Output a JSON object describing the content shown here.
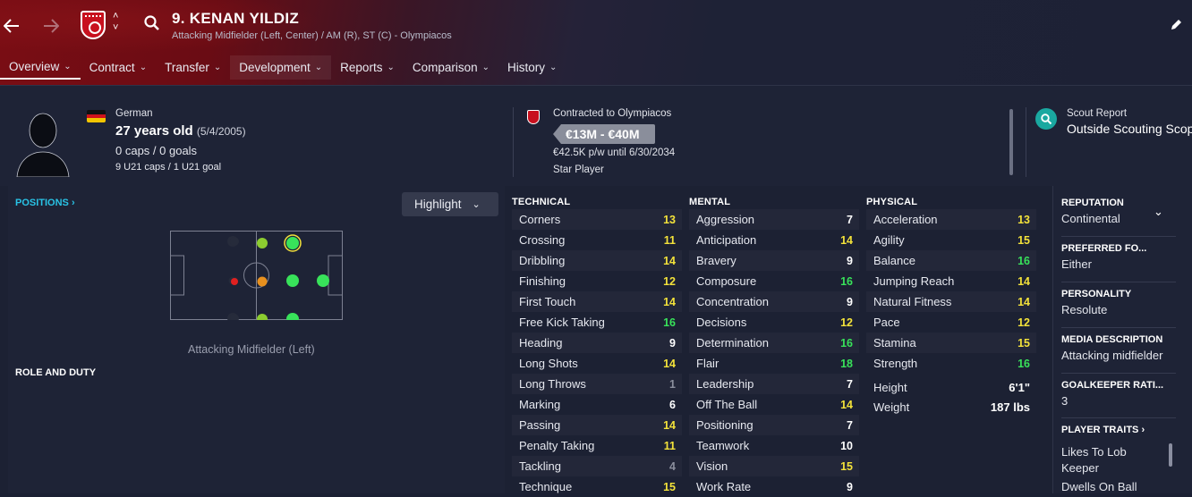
{
  "header": {
    "title": "9. KENAN YILDIZ",
    "subtitle": "Attacking Midfielder (Left, Center) / AM (R), ST (C) - Olympiacos",
    "back_icon": "arrow-left-icon",
    "forward_icon": "arrow-right-icon",
    "updown": [
      "˄",
      "˅"
    ]
  },
  "tabs": [
    {
      "label": "Overview"
    },
    {
      "label": "Contract"
    },
    {
      "label": "Transfer"
    },
    {
      "label": "Development"
    },
    {
      "label": "Reports"
    },
    {
      "label": "Comparison"
    },
    {
      "label": "History"
    }
  ],
  "player": {
    "nationality": "German",
    "age": "27 years old",
    "dob": "(5/4/2005)",
    "caps": "0 caps / 0 goals",
    "u21": "9 U21 caps / 1 U21 goal"
  },
  "contract": {
    "club": "Contracted to Olympiacos",
    "value": "€13M - €40M",
    "wage": "€42.5K p/w until 6/30/2034",
    "status": "Star Player"
  },
  "scout": {
    "label": "Scout Report",
    "value": "Outside Scouting Scope"
  },
  "positions": {
    "link": "POSITIONS ›",
    "highlight": "Highlight",
    "pitch_label": "Attacking Midfielder (Left)",
    "role_title": "ROLE AND DUTY"
  },
  "technical": {
    "title": "TECHNICAL",
    "items": [
      {
        "name": "Corners",
        "value": "13",
        "tone": "yellow"
      },
      {
        "name": "Crossing",
        "value": "11",
        "tone": "yellow"
      },
      {
        "name": "Dribbling",
        "value": "14",
        "tone": "yellow"
      },
      {
        "name": "Finishing",
        "value": "12",
        "tone": "yellow"
      },
      {
        "name": "First Touch",
        "value": "14",
        "tone": "yellow"
      },
      {
        "name": "Free Kick Taking",
        "value": "16",
        "tone": "green"
      },
      {
        "name": "Heading",
        "value": "9",
        "tone": "white"
      },
      {
        "name": "Long Shots",
        "value": "14",
        "tone": "yellow"
      },
      {
        "name": "Long Throws",
        "value": "1",
        "tone": "grey"
      },
      {
        "name": "Marking",
        "value": "6",
        "tone": "white"
      },
      {
        "name": "Passing",
        "value": "14",
        "tone": "yellow"
      },
      {
        "name": "Penalty Taking",
        "value": "11",
        "tone": "yellow"
      },
      {
        "name": "Tackling",
        "value": "4",
        "tone": "grey"
      },
      {
        "name": "Technique",
        "value": "15",
        "tone": "yellow"
      }
    ]
  },
  "mental": {
    "title": "MENTAL",
    "items": [
      {
        "name": "Aggression",
        "value": "7",
        "tone": "white"
      },
      {
        "name": "Anticipation",
        "value": "14",
        "tone": "yellow"
      },
      {
        "name": "Bravery",
        "value": "9",
        "tone": "white"
      },
      {
        "name": "Composure",
        "value": "16",
        "tone": "green"
      },
      {
        "name": "Concentration",
        "value": "9",
        "tone": "white"
      },
      {
        "name": "Decisions",
        "value": "12",
        "tone": "yellow"
      },
      {
        "name": "Determination",
        "value": "16",
        "tone": "green"
      },
      {
        "name": "Flair",
        "value": "18",
        "tone": "green"
      },
      {
        "name": "Leadership",
        "value": "7",
        "tone": "white"
      },
      {
        "name": "Off The Ball",
        "value": "14",
        "tone": "yellow"
      },
      {
        "name": "Positioning",
        "value": "7",
        "tone": "white"
      },
      {
        "name": "Teamwork",
        "value": "10",
        "tone": "white"
      },
      {
        "name": "Vision",
        "value": "15",
        "tone": "yellow"
      },
      {
        "name": "Work Rate",
        "value": "9",
        "tone": "white"
      }
    ]
  },
  "physical": {
    "title": "PHYSICAL",
    "items": [
      {
        "name": "Acceleration",
        "value": "13",
        "tone": "yellow"
      },
      {
        "name": "Agility",
        "value": "15",
        "tone": "yellow"
      },
      {
        "name": "Balance",
        "value": "16",
        "tone": "green"
      },
      {
        "name": "Jumping Reach",
        "value": "14",
        "tone": "yellow"
      },
      {
        "name": "Natural Fitness",
        "value": "14",
        "tone": "yellow"
      },
      {
        "name": "Pace",
        "value": "12",
        "tone": "yellow"
      },
      {
        "name": "Stamina",
        "value": "15",
        "tone": "yellow"
      },
      {
        "name": "Strength",
        "value": "16",
        "tone": "green"
      }
    ],
    "height_label": "Height",
    "height": "6'1\"",
    "weight_label": "Weight",
    "weight": "187 lbs"
  },
  "side": {
    "reputation_title": "REPUTATION",
    "reputation": "Continental",
    "foot_title": "PREFERRED FO...",
    "foot": "Either",
    "personality_title": "PERSONALITY",
    "personality": "Resolute",
    "media_title": "MEDIA DESCRIPTION",
    "media": "Attacking midfielder",
    "gk_title": "GOALKEEPER RATI...",
    "gk": "3",
    "traits_title": "PLAYER TRAITS ›",
    "trait1": "Likes To Lob Keeper",
    "trait2": "Dwells On Ball"
  },
  "colors": {
    "yellow": "#f3e23a",
    "green": "#38e25a",
    "accent": "#29c3e6",
    "club_red": "#c8101e"
  }
}
